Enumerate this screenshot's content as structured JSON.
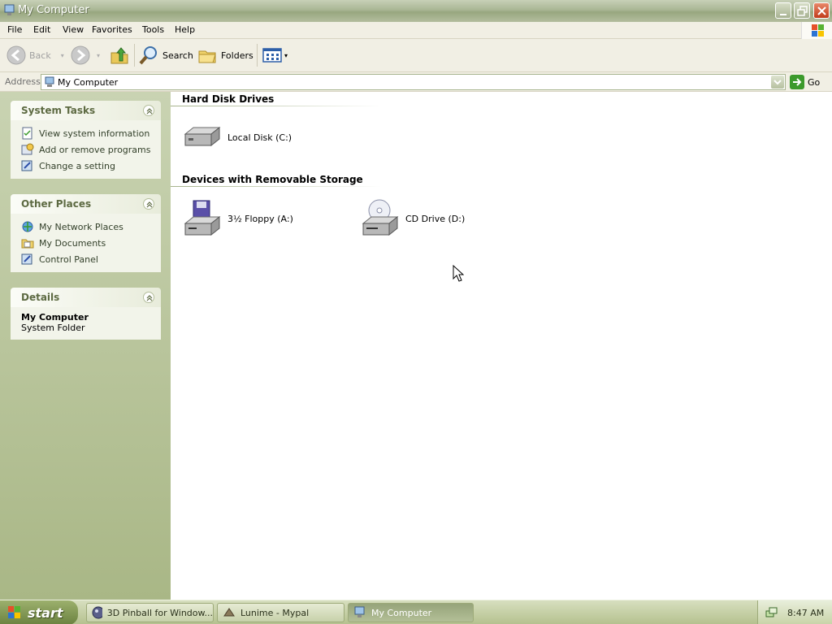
{
  "window": {
    "title": "My Computer"
  },
  "menu": [
    "File",
    "Edit",
    "View",
    "Favorites",
    "Tools",
    "Help"
  ],
  "toolbar": {
    "back": "Back",
    "search": "Search",
    "folders": "Folders"
  },
  "address": {
    "label": "Address",
    "value": "My Computer",
    "go": "Go"
  },
  "taskpane": {
    "system_tasks": {
      "title": "System Tasks",
      "items": [
        "View system information",
        "Add or remove programs",
        "Change a setting"
      ]
    },
    "other_places": {
      "title": "Other Places",
      "items": [
        "My Network Places",
        "My Documents",
        "Control Panel"
      ]
    },
    "details": {
      "title": "Details",
      "name": "My Computer",
      "type": "System Folder"
    }
  },
  "content": {
    "hard_disks": {
      "title": "Hard Disk Drives",
      "items": [
        "Local Disk (C:)"
      ]
    },
    "removable": {
      "title": "Devices with Removable Storage",
      "items": [
        "3½ Floppy (A:)",
        "CD Drive (D:)"
      ]
    }
  },
  "taskbar": {
    "start": "start",
    "tasks": [
      "3D Pinball for Window...",
      "Lunime - Mypal",
      "My Computer"
    ],
    "clock": "8:47 AM"
  },
  "colors": {
    "accent": "#a9b694",
    "pane": "#c9d3b2",
    "task_link": "#33402a"
  }
}
